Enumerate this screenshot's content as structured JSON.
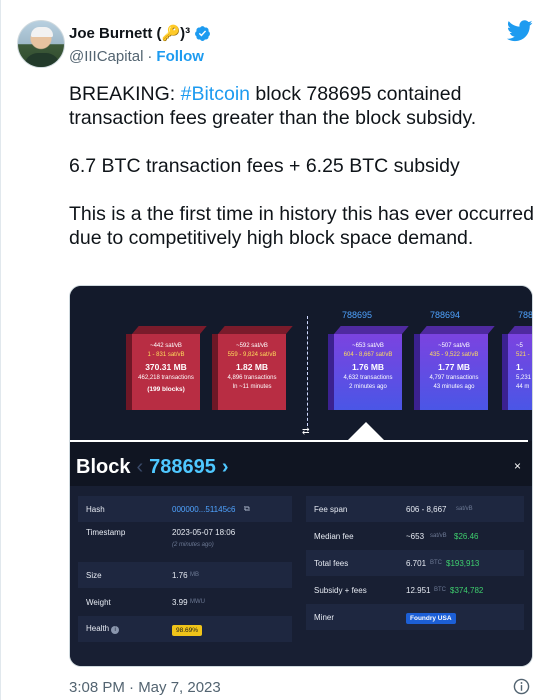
{
  "author": {
    "name": "Joe Burnett (🔑)³",
    "handle": "@IIICapital",
    "separator": "·",
    "follow": "Follow"
  },
  "tweet": {
    "p1_prefix": "BREAKING: ",
    "p1_hashtag": "#Bitcoin",
    "p1_suffix": " block 788695 contained transaction fees greater than the block subsidy.",
    "p2": "6.7 BTC transaction fees + 6.25 BTC subsidy",
    "p3": "This is a the first time in history this has ever occurred due to competitively high block space demand."
  },
  "media": {
    "pending_blocks": [
      {
        "fee": "~442 sat/vB",
        "range": "1 - 831 sat/vB",
        "size": "370.31 MB",
        "txs": "462,218 transactions",
        "eta": "(199 blocks)"
      },
      {
        "fee": "~592 sat/vB",
        "range": "559 - 9,824 sat/vB",
        "size": "1.82 MB",
        "txs": "4,896 transactions",
        "eta": "In ~11 minutes"
      }
    ],
    "mined_blocks": [
      {
        "height": "788695",
        "fee": "~653 sat/vB",
        "range": "604 - 8,667 sat/vB",
        "size": "1.76 MB",
        "txs": "4,632 transactions",
        "age": "2 minutes ago"
      },
      {
        "height": "788694",
        "fee": "~507 sat/vB",
        "range": "435 - 9,522 sat/vB",
        "size": "1.77 MB",
        "txs": "4,797 transactions",
        "age": "43 minutes ago"
      },
      {
        "height": "788",
        "fee": "~5",
        "range": "521 -",
        "size": "1.",
        "txs": "5,231",
        "age": "44 m"
      }
    ],
    "swap_icon": "⇄",
    "block_title": "Block",
    "block_lt": "‹",
    "block_number": "788695",
    "block_gt": "›",
    "close": "×",
    "left_rows": {
      "hash_label": "Hash",
      "hash_value": "000000...51145c6",
      "copy_icon": "⧉",
      "timestamp_label": "Timestamp",
      "timestamp_value": "2023-05-07 18:06",
      "timestamp_sub": "(2 minutes ago)",
      "size_label": "Size",
      "size_value": "1.76",
      "size_unit": "MB",
      "weight_label": "Weight",
      "weight_value": "3.99",
      "weight_unit": "MWU",
      "health_label": "Health",
      "health_info": "i",
      "health_value": "98.69%"
    },
    "right_rows": {
      "feespan_label": "Fee span",
      "feespan_value": "606 - 8,667",
      "feespan_unit": "sat/vB",
      "median_label": "Median fee",
      "median_value": "~653",
      "median_unit": "sat/vB",
      "median_usd": "$26.46",
      "total_label": "Total fees",
      "total_value": "6.701",
      "total_unit": "BTC",
      "total_usd": "$193,913",
      "subsidy_label": "Subsidy + fees",
      "subsidy_value": "12.951",
      "subsidy_unit": "BTC",
      "subsidy_usd": "$374,782",
      "miner_label": "Miner",
      "miner_value": "Foundry USA"
    }
  },
  "footer": {
    "timestamp": "3:08 PM · May 7, 2023"
  },
  "colors": {
    "twitter_blue": "#1d9bf0",
    "block_red": "#b82d43",
    "block_purple": "#7b43e0",
    "health_yellow": "#f0c419",
    "fee_green": "#3ecf6e"
  }
}
